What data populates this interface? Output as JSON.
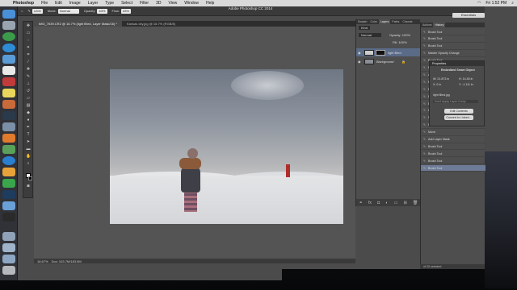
{
  "menubar": {
    "app": "Photoshop",
    "items": [
      "File",
      "Edit",
      "Image",
      "Layer",
      "Type",
      "Select",
      "Filter",
      "3D",
      "View",
      "Window",
      "Help"
    ],
    "time": "Fri 1:52 PM"
  },
  "window": {
    "title": "Adobe Photoshop CC 2014",
    "workspace": "Essentials"
  },
  "options": {
    "size": "1200",
    "mode_label": "Mode:",
    "mode": "Normal",
    "opacity_label": "Opacity:",
    "opacity": "63%",
    "flow_label": "Flow:",
    "flow": "63%"
  },
  "document": {
    "tab_active": "IMG_7639.CR2 @ 16.7% (light filled, Layer Mask/16) *",
    "tab_other": "Kansas city.jpg @ 16.7% (RGB/8)",
    "zoom": "16.67%",
    "doc_info": "Doc: 103.7M/183.5M"
  },
  "layers": {
    "tabs": [
      "Swatch",
      "Color",
      "Layers",
      "Paths",
      "Channe"
    ],
    "kind": "Kind",
    "blend": "Normal",
    "opacity": "Opacity: 100%",
    "fill": "Fill: 100%",
    "rows": [
      {
        "name": "light filled",
        "selected": true
      },
      {
        "name": "Background",
        "selected": false
      }
    ]
  },
  "history": {
    "tabs": [
      "Actions",
      "History"
    ],
    "items": [
      "Brush Tool",
      "Brush Tool",
      "Brush Tool",
      "Master Opacity Change",
      "Brush Tool",
      "Brush Tool",
      "Add Layer Mask",
      "Brush Tool",
      "Brush Tool",
      "Brush Tool",
      "Brush Tool",
      "Delete Layer",
      "Place Embedded Smart Object",
      "Master Opacity Change",
      "Move",
      "Add Layer Mask",
      "Brush Tool",
      "Brush Tool",
      "Brush Tool",
      "Brush Tool"
    ],
    "footer": "of 20 selected"
  },
  "properties": {
    "title": "Properties",
    "subtitle": "Embedded Smart Object",
    "w": "W: 21.873 in",
    "h": "H: 14.45 in",
    "x": "X: 0 in",
    "y": "Y: -1.111 in",
    "file": "light filled.jpg",
    "comp": "Don't Apply Layer Comp",
    "edit_btn": "Edit Contents",
    "convert_btn": "Convert to Linked..."
  }
}
